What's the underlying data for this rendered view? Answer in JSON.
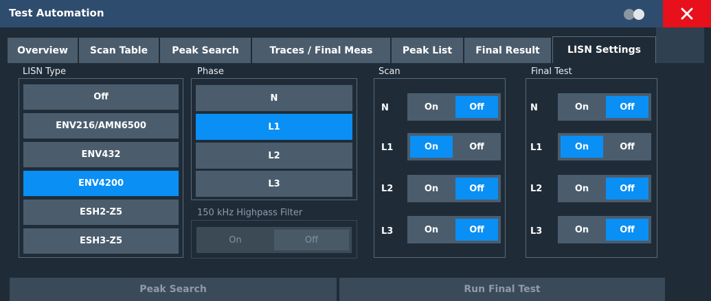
{
  "window": {
    "title": "Test Automation",
    "toggle_icon": "toggle-icon",
    "close_icon": "close-icon"
  },
  "tabs": [
    {
      "label": "Overview",
      "active": false
    },
    {
      "label": "Scan Table",
      "active": false
    },
    {
      "label": "Peak Search",
      "active": false
    },
    {
      "label": "Traces / Final Meas",
      "active": false
    },
    {
      "label": "Peak List",
      "active": false
    },
    {
      "label": "Final Result",
      "active": false
    },
    {
      "label": "LISN Settings",
      "active": true
    }
  ],
  "lisn_type": {
    "label": "LISN Type",
    "options": [
      "Off",
      "ENV216/AMN6500",
      "ENV432",
      "ENV4200",
      "ESH2-Z5",
      "ESH3-Z5"
    ],
    "selected": "ENV4200"
  },
  "phase": {
    "label": "Phase",
    "options": [
      "N",
      "L1",
      "L2",
      "L3"
    ],
    "selected": "L1"
  },
  "highpass": {
    "label": "150 kHz Highpass Filter",
    "on_label": "On",
    "off_label": "Off",
    "enabled": false
  },
  "scan": {
    "label": "Scan",
    "rows": [
      {
        "phase": "N",
        "on_label": "On",
        "off_label": "Off",
        "value": "Off"
      },
      {
        "phase": "L1",
        "on_label": "On",
        "off_label": "Off",
        "value": "On"
      },
      {
        "phase": "L2",
        "on_label": "On",
        "off_label": "Off",
        "value": "Off"
      },
      {
        "phase": "L3",
        "on_label": "On",
        "off_label": "Off",
        "value": "Off"
      }
    ]
  },
  "final_test": {
    "label": "Final Test",
    "rows": [
      {
        "phase": "N",
        "on_label": "On",
        "off_label": "Off",
        "value": "Off"
      },
      {
        "phase": "L1",
        "on_label": "On",
        "off_label": "Off",
        "value": "On"
      },
      {
        "phase": "L2",
        "on_label": "On",
        "off_label": "Off",
        "value": "Off"
      },
      {
        "phase": "L3",
        "on_label": "On",
        "off_label": "Off",
        "value": "Off"
      }
    ]
  },
  "actions": {
    "peak_search": "Peak Search",
    "run_final_test": "Run Final Test"
  },
  "colors": {
    "accent": "#0a8ff5",
    "close": "#e8101a",
    "title_bar": "#2d4c6e",
    "background": "#1f2c38",
    "button": "#4b5d6d"
  }
}
